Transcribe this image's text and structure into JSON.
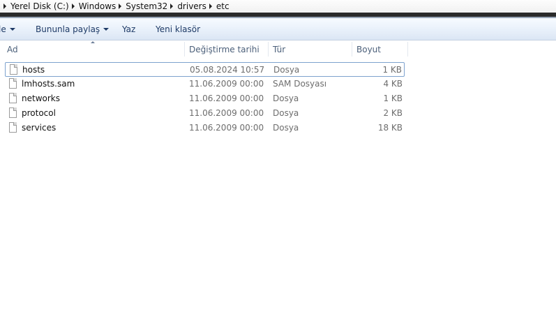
{
  "address": {
    "crumbs": [
      "Yerel Disk (C:)",
      "Windows",
      "System32",
      "drivers",
      "etc"
    ]
  },
  "toolbar": {
    "partial_label": "le",
    "share_label": "Bununla paylaş",
    "print_label": "Yaz",
    "new_folder_label": "Yeni klasör"
  },
  "columns": {
    "name": "Ad",
    "date": "Değiştirme tarihi",
    "type": "Tür",
    "size": "Boyut"
  },
  "files": [
    {
      "name": "hosts",
      "date": "05.08.2024 10:57",
      "type": "Dosya",
      "size": "1 KB",
      "icon": "file-icon"
    },
    {
      "name": "lmhosts.sam",
      "date": "11.06.2009 00:00",
      "type": "SAM Dosyası",
      "size": "4 KB",
      "icon": "file-icon"
    },
    {
      "name": "networks",
      "date": "11.06.2009 00:00",
      "type": "Dosya",
      "size": "1 KB",
      "icon": "file-icon"
    },
    {
      "name": "protocol",
      "date": "11.06.2009 00:00",
      "type": "Dosya",
      "size": "2 KB",
      "icon": "file-icon"
    },
    {
      "name": "services",
      "date": "11.06.2009 00:00",
      "type": "Dosya",
      "size": "18 KB",
      "icon": "file-icon"
    }
  ],
  "colors": {
    "toolbar_text": "#1e3a66",
    "header_text": "#4c607a",
    "focus_border": "#7da2ce"
  }
}
